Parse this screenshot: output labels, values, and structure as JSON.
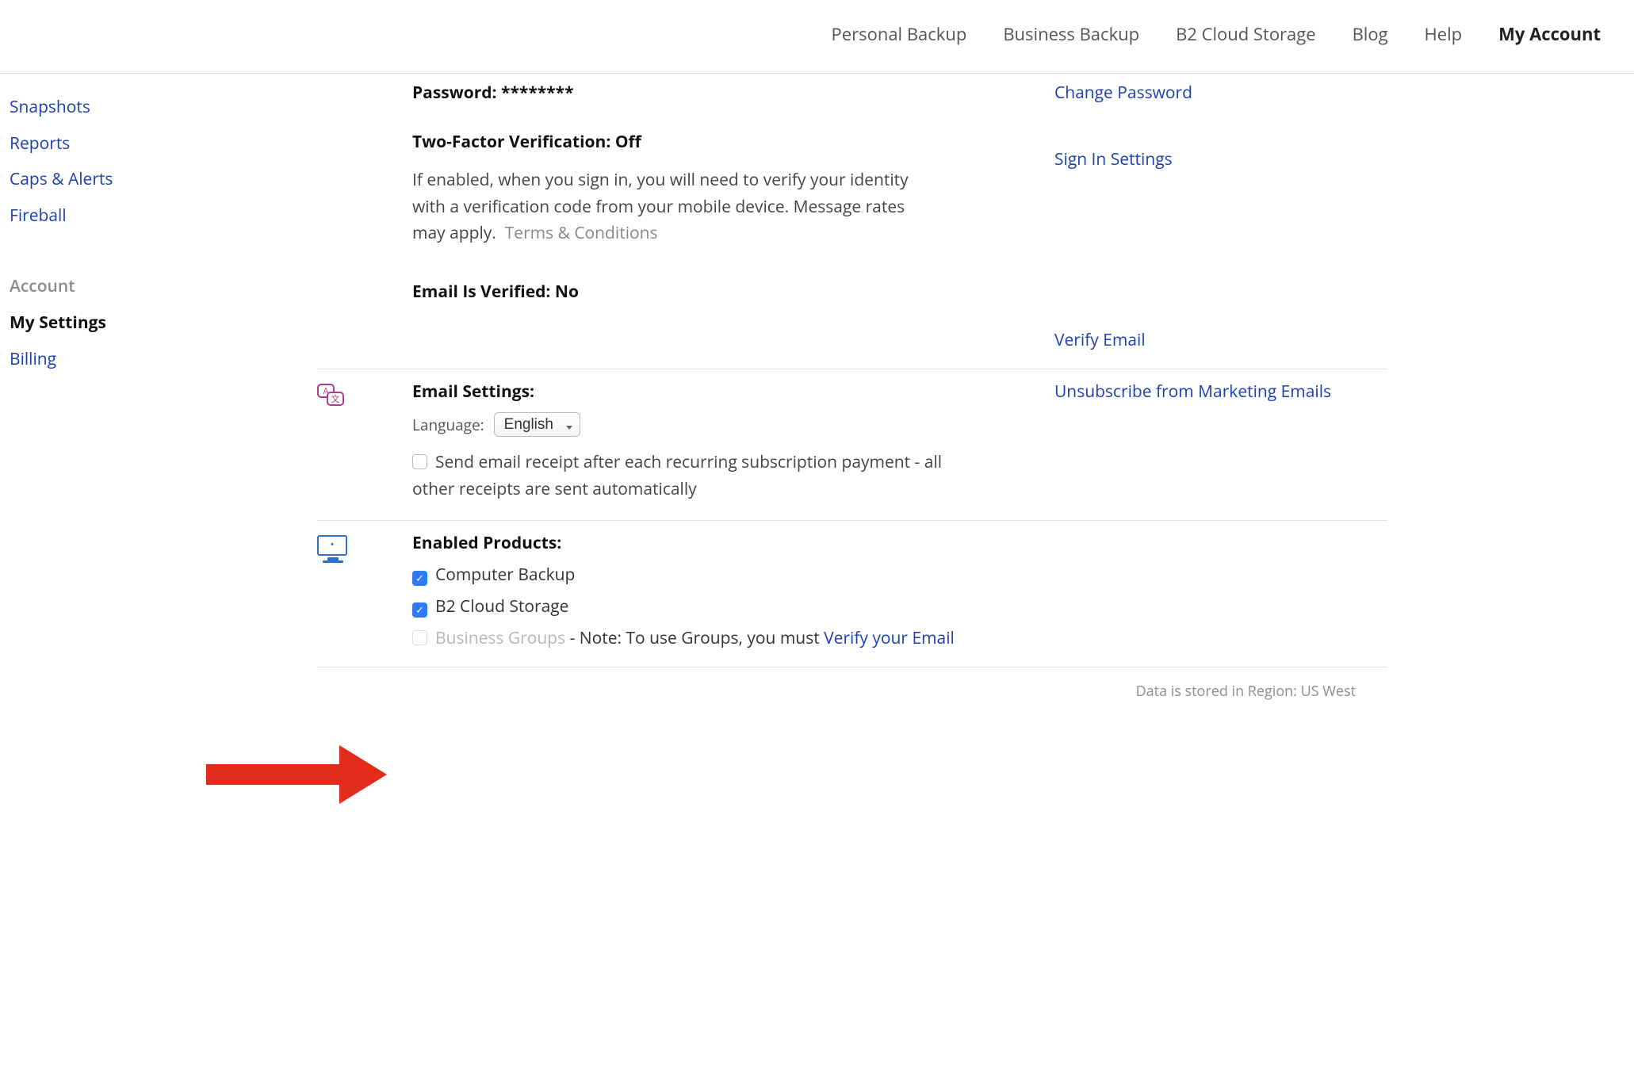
{
  "topnav": {
    "items": [
      {
        "label": "Personal Backup"
      },
      {
        "label": "Business Backup"
      },
      {
        "label": "B2 Cloud Storage"
      },
      {
        "label": "Blog"
      },
      {
        "label": "Help"
      },
      {
        "label": "My Account"
      }
    ],
    "active_index": 5
  },
  "sidebar": {
    "items_top": [
      {
        "label": "Snapshots"
      },
      {
        "label": "Reports"
      },
      {
        "label": "Caps & Alerts"
      },
      {
        "label": "Fireball"
      }
    ],
    "account_heading": "Account",
    "items_account": [
      {
        "label": "My Settings",
        "current": true
      },
      {
        "label": "Billing",
        "current": false
      }
    ]
  },
  "security": {
    "password_label": "Password:",
    "password_value": "********",
    "change_password": "Change Password",
    "two_factor_label": "Two-Factor Verification:",
    "two_factor_value": "Off",
    "sign_in_settings": "Sign In Settings",
    "two_factor_desc": "If enabled, when you sign in, you will need to verify your identity with a verification code from your mobile device. Message rates may apply.",
    "terms_link": "Terms & Conditions",
    "email_verified_label": "Email Is Verified:",
    "email_verified_value": "No",
    "verify_email": "Verify Email"
  },
  "email_settings": {
    "heading": "Email Settings:",
    "unsubscribe": "Unsubscribe from Marketing Emails",
    "language_label": "Language:",
    "language_value": "English",
    "receipt_checkbox_label": "Send email receipt after each recurring subscription payment - all other receipts are sent automatically",
    "receipt_checked": false
  },
  "products": {
    "heading": "Enabled Products:",
    "items": [
      {
        "label": "Computer Backup",
        "checked": true,
        "disabled": false
      },
      {
        "label": "B2 Cloud Storage",
        "checked": true,
        "disabled": false
      },
      {
        "label": "Business Groups",
        "checked": false,
        "disabled": true
      }
    ],
    "groups_note_prefix": " - Note: To use Groups, you must ",
    "groups_note_link": "Verify your Email"
  },
  "footer": {
    "region_label": "Data is stored in Region:",
    "region_value": "US West"
  }
}
